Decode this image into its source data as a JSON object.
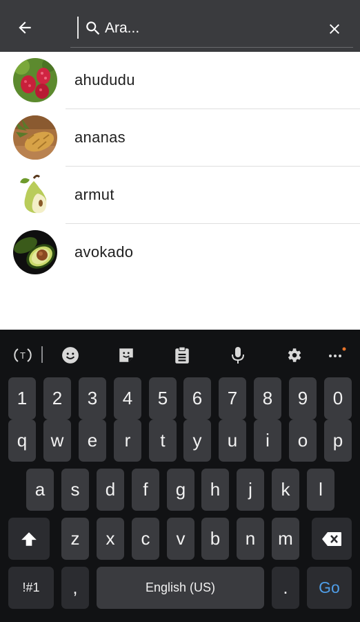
{
  "search": {
    "value": "Ara...",
    "placeholder": ""
  },
  "results": [
    {
      "label": "ahududu",
      "icon": "raspberry-image"
    },
    {
      "label": "ananas",
      "icon": "pineapple-image"
    },
    {
      "label": "armut",
      "icon": "pear-image"
    },
    {
      "label": "avokado",
      "icon": "avocado-image"
    }
  ],
  "keyboard": {
    "numbers": [
      "1",
      "2",
      "3",
      "4",
      "5",
      "6",
      "7",
      "8",
      "9",
      "0"
    ],
    "row1": [
      "q",
      "w",
      "e",
      "r",
      "t",
      "y",
      "u",
      "i",
      "o",
      "p"
    ],
    "row2": [
      "a",
      "s",
      "d",
      "f",
      "g",
      "h",
      "j",
      "k",
      "l"
    ],
    "row3": [
      "z",
      "x",
      "c",
      "v",
      "b",
      "n",
      "m"
    ],
    "symbols_label": "!#1",
    "comma_label": ",",
    "space_label": "English (US)",
    "period_label": ".",
    "go_label": "Go"
  },
  "colors": {
    "appbar": "#3a3b3e",
    "keyboard_bg": "#111214",
    "key": "#3a3b3f",
    "go": "#4f9ee8",
    "notify_dot": "#e8742a"
  }
}
